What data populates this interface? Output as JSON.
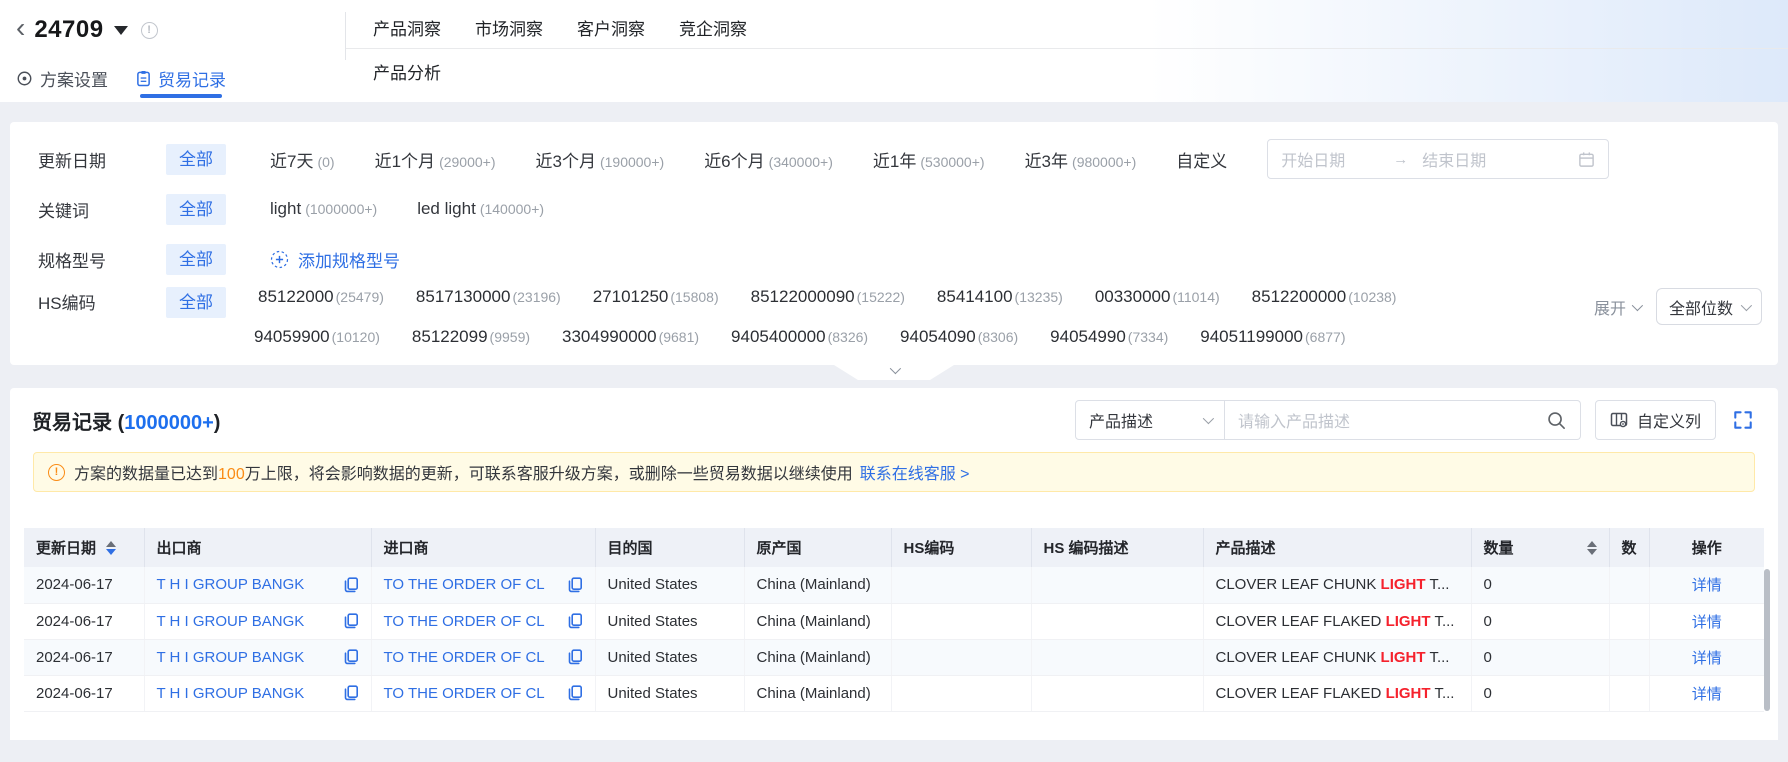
{
  "header": {
    "back_icon": "‹",
    "plan_id": "24709",
    "info_icon": "!",
    "tab_settings": "方案设置",
    "tab_records": "贸易记录",
    "nav": [
      "产品洞察",
      "市场洞察",
      "客户洞察",
      "竞企洞察"
    ],
    "subnav": "产品分析"
  },
  "filters": {
    "date": {
      "label": "更新日期",
      "all": "全部",
      "options": [
        {
          "text": "近7天",
          "count": "(0)"
        },
        {
          "text": "近1个月",
          "count": "(29000+)"
        },
        {
          "text": "近3个月",
          "count": "(190000+)"
        },
        {
          "text": "近6个月",
          "count": "(340000+)"
        },
        {
          "text": "近1年",
          "count": "(530000+)"
        },
        {
          "text": "近3年",
          "count": "(980000+)"
        }
      ],
      "custom": "自定义",
      "start_placeholder": "开始日期",
      "range_arrow": "→",
      "end_placeholder": "结束日期"
    },
    "keyword": {
      "label": "关键词",
      "all": "全部",
      "options": [
        {
          "text": "light",
          "count": "(1000000+)"
        },
        {
          "text": "led light",
          "count": "(140000+)"
        }
      ]
    },
    "spec": {
      "label": "规格型号",
      "all": "全部",
      "add_label": "添加规格型号"
    },
    "hs": {
      "label": "HS编码",
      "all": "全部",
      "line1": [
        {
          "text": "85122000",
          "count": "(25479)"
        },
        {
          "text": "8517130000",
          "count": "(23196)"
        },
        {
          "text": "27101250",
          "count": "(15808)"
        },
        {
          "text": "85122000090",
          "count": "(15222)"
        },
        {
          "text": "85414100",
          "count": "(13235)"
        },
        {
          "text": "00330000",
          "count": "(11014)"
        },
        {
          "text": "8512200000",
          "count": "(10238)"
        }
      ],
      "line2": [
        {
          "text": "94059900",
          "count": "(10120)"
        },
        {
          "text": "85122099",
          "count": "(9959)"
        },
        {
          "text": "3304990000",
          "count": "(9681)"
        },
        {
          "text": "9405400000",
          "count": "(8326)"
        },
        {
          "text": "94054090",
          "count": "(8306)"
        },
        {
          "text": "94054990",
          "count": "(7334)"
        },
        {
          "text": "94051199000",
          "count": "(6877)"
        }
      ],
      "expand_label": "展开",
      "digits_label": "全部位数"
    }
  },
  "records": {
    "title": "贸易记录",
    "count_open": "(",
    "count": "1000000+",
    "count_close": ")",
    "search": {
      "category": "产品描述",
      "placeholder": "请输入产品描述"
    },
    "customize_columns": "自定义列",
    "banner": {
      "pre": "方案的数据量已达到",
      "highlight": "100",
      "post": "万上限，将会影响数据的更新，可联系客服升级方案，或删除一些贸易数据以继续使用",
      "link": "联系在线客服 >"
    },
    "table": {
      "headers": [
        "更新日期",
        "出口商",
        "进口商",
        "目的国",
        "原产国",
        "HS编码",
        "HS 编码描述",
        "产品描述",
        "数量",
        "数",
        "操作"
      ],
      "rows": [
        {
          "date": "2024-06-17",
          "exporter": "T H I GROUP BANGK",
          "importer": "TO THE ORDER OF CL",
          "destination": "United States",
          "origin": "China (Mainland)",
          "hs_code": "",
          "hs_desc": "",
          "product": {
            "pre": "CLOVER LEAF CHUNK ",
            "hl": "LIGHT",
            "post": " T..."
          },
          "qty": "0",
          "extra": "",
          "action": "详情"
        },
        {
          "date": "2024-06-17",
          "exporter": "T H I GROUP BANGK",
          "importer": "TO THE ORDER OF CL",
          "destination": "United States",
          "origin": "China (Mainland)",
          "hs_code": "",
          "hs_desc": "",
          "product": {
            "pre": "CLOVER LEAF FLAKED ",
            "hl": "LIGHT",
            "post": " T..."
          },
          "qty": "0",
          "extra": "",
          "action": "详情"
        },
        {
          "date": "2024-06-17",
          "exporter": "T H I GROUP BANGK",
          "importer": "TO THE ORDER OF CL",
          "destination": "United States",
          "origin": "China (Mainland)",
          "hs_code": "",
          "hs_desc": "",
          "product": {
            "pre": "CLOVER LEAF CHUNK ",
            "hl": "LIGHT",
            "post": " T..."
          },
          "qty": "0",
          "extra": "",
          "action": "详情"
        },
        {
          "date": "2024-06-17",
          "exporter": "T H I GROUP BANGK",
          "importer": "TO THE ORDER OF CL",
          "destination": "United States",
          "origin": "China (Mainland)",
          "hs_code": "",
          "hs_desc": "",
          "product": {
            "pre": "CLOVER LEAF FLAKED ",
            "hl": "LIGHT",
            "post": " T..."
          },
          "qty": "0",
          "extra": "",
          "action": "详情"
        }
      ]
    }
  }
}
